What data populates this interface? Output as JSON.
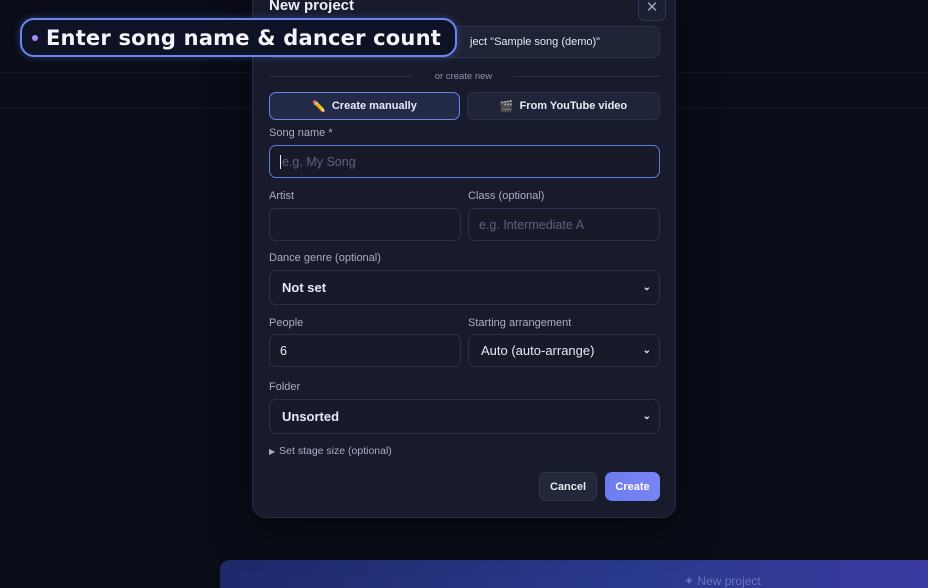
{
  "background": {
    "bottom_bar_label": "✦ New project"
  },
  "modal": {
    "title": "New project",
    "close_label": "✕",
    "demo_button_label": "ject \"Sample song (demo)\"",
    "divider_text": "or create new",
    "tabs": [
      {
        "label": "Create manually",
        "icon": "pencil-icon",
        "glyph": "✏️",
        "active": true
      },
      {
        "label": "From YouTube video",
        "icon": "clapperboard-icon",
        "glyph": "🎬",
        "active": false
      }
    ],
    "song_name": {
      "label": "Song name *",
      "placeholder": "e.g. My Song",
      "value": ""
    },
    "artist": {
      "label": "Artist",
      "placeholder": "",
      "value": ""
    },
    "class": {
      "label": "Class (optional)",
      "placeholder": "e.g. Intermediate A",
      "value": ""
    },
    "genre": {
      "label": "Dance genre (optional)",
      "selected": "Not set"
    },
    "people": {
      "label": "People",
      "value": "6"
    },
    "arrangement": {
      "label": "Starting arrangement",
      "selected": "Auto (auto-arrange)"
    },
    "folder": {
      "label": "Folder",
      "selected": "Unsorted"
    },
    "stage_toggle": "Set stage size (optional)",
    "cancel_label": "Cancel",
    "create_label": "Create"
  },
  "tooltip": {
    "text": "Enter song name & dancer count"
  },
  "colors": {
    "accent": "#6a84e8",
    "create_button": "#6a7df0",
    "modal_bg": "#171b2b"
  }
}
